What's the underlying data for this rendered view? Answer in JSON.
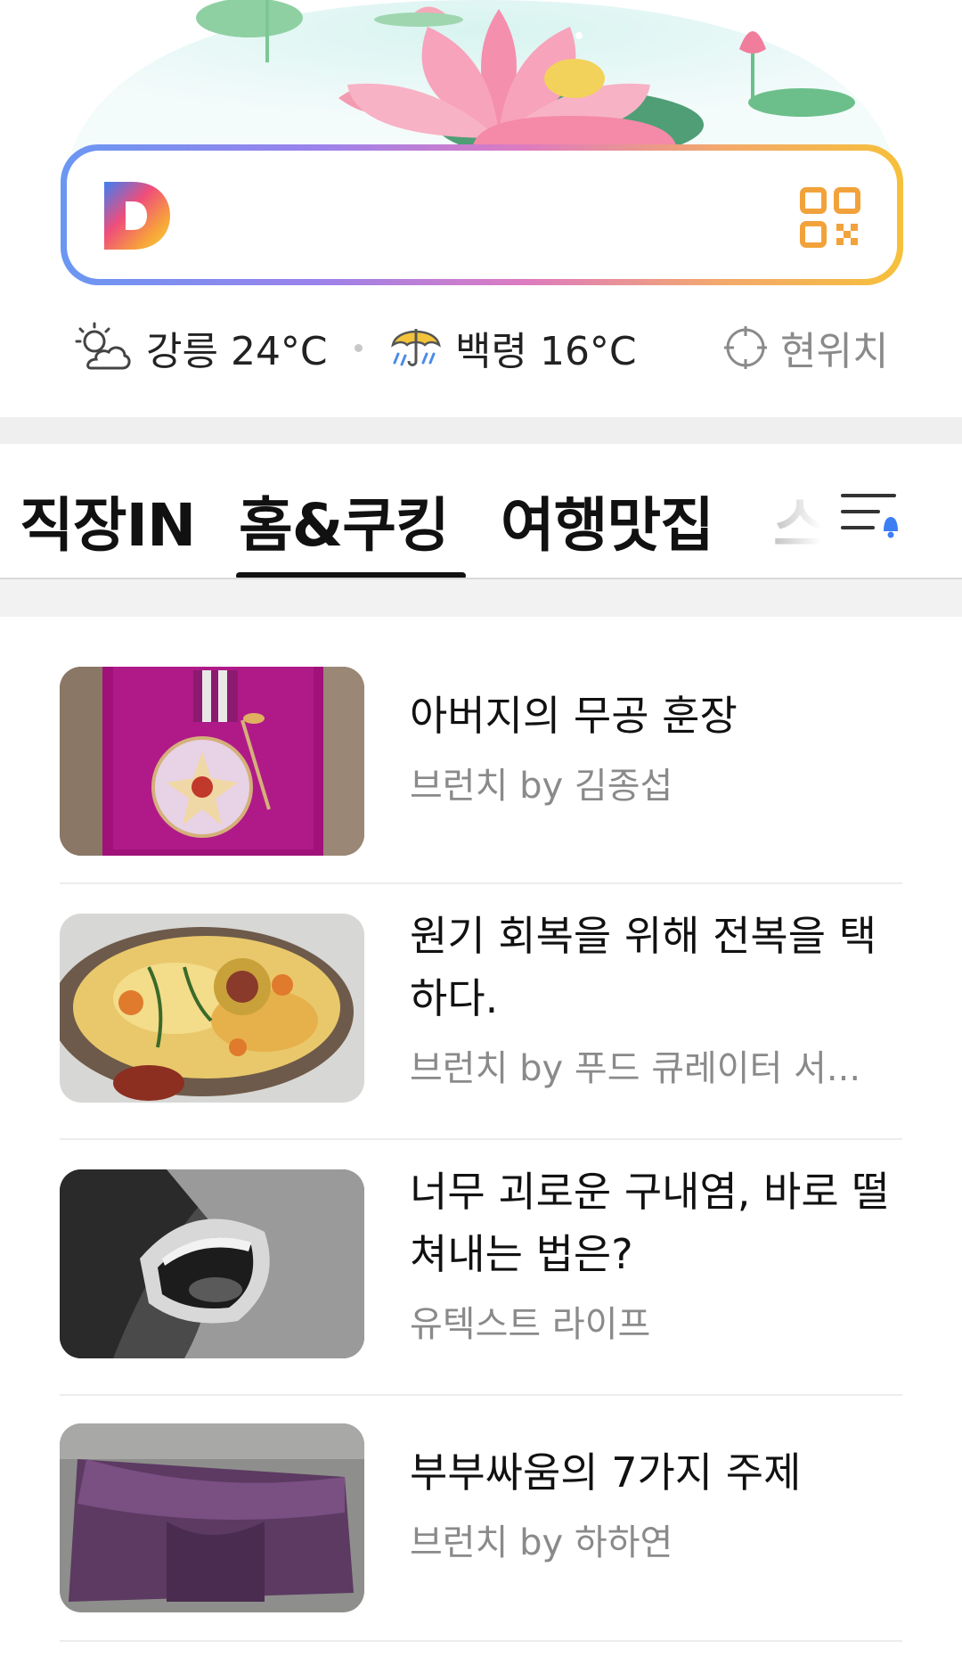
{
  "search": {
    "logo_letter": "D",
    "logo_icon": "daum-d-logo",
    "qr_icon": "qr-code-icon"
  },
  "weather": [
    {
      "icon": "partly-cloudy-icon",
      "text": "강릉 24°C"
    },
    {
      "icon": "umbrella-rain-icon",
      "text": "백령 16°C"
    },
    {
      "icon": "location-target-icon",
      "text": "현위치"
    }
  ],
  "tabs": {
    "items": [
      "직장IN",
      "홈&쿠킹",
      "여행맛집",
      "스"
    ],
    "active": "홈&쿠킹",
    "menu_icon": "menu-notification-icon"
  },
  "articles": [
    {
      "title": "아버지의 무공 훈장",
      "source": "브런치 by 김종섭"
    },
    {
      "title": "원기 회복을 위해 전복을 택하다.",
      "source": "브런치 by 푸드 큐레이터 서..."
    },
    {
      "title": "너무 괴로운 구내염, 바로 떨쳐내는 법은?",
      "source": "유텍스트 라이프"
    },
    {
      "title": "부부싸움의 7가지 주제",
      "source": "브런치 by 하하연"
    }
  ]
}
